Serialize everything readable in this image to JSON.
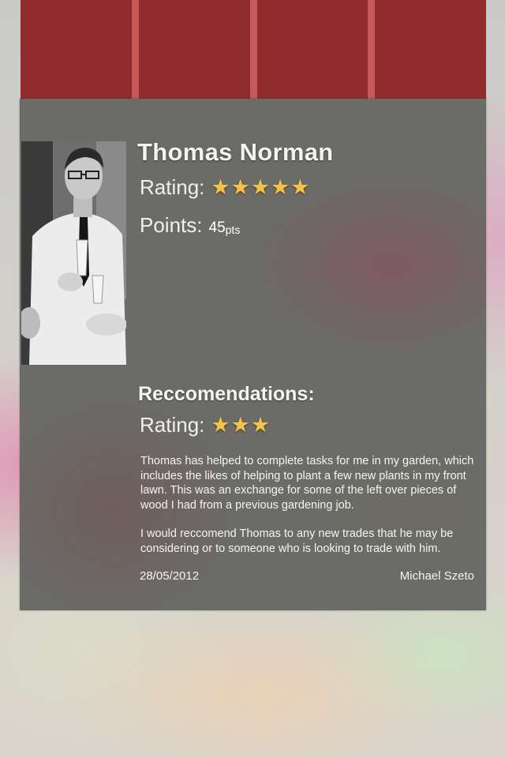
{
  "top_tabs": [
    {
      "label": ""
    },
    {
      "label": ""
    },
    {
      "label": ""
    },
    {
      "label": ""
    }
  ],
  "profile": {
    "name": "Thomas Norman",
    "rating_label": "Rating:",
    "rating_stars": 5,
    "points_label": "Points:",
    "points_value": "45",
    "points_unit": "pts"
  },
  "recommendations": {
    "title": "Reccomendations:",
    "rating_label": "Rating:",
    "rating_stars": 3,
    "paragraphs": [
      "Thomas has helped to complete tasks for me in my garden, which includes the likes of helping to plant a few new plants in my front lawn. This was an exchange for some of the left over pieces of wood I had from a previous gardening job.",
      "I would reccomend Thomas to any new trades that he may be considering or to someone who is looking to trade with him."
    ],
    "date": "28/05/2012",
    "author": "Michael Szeto"
  },
  "icons": {
    "star": "star-icon"
  },
  "colors": {
    "header_red": "#902c2d",
    "tab_divider": "#c7595a",
    "star_gold": "#f2c24b"
  }
}
